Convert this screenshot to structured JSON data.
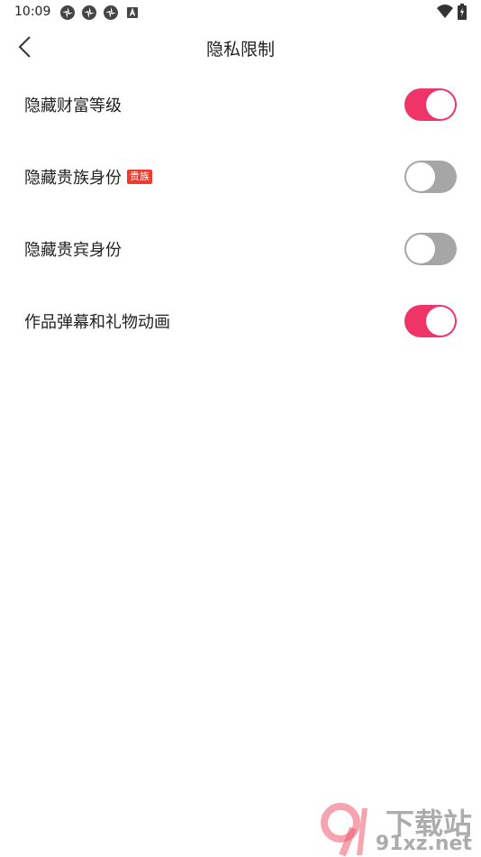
{
  "status_bar": {
    "time": "10:09",
    "left_icons": [
      "app-notification-icon",
      "app-notification-icon",
      "app-notification-icon",
      "text-a-icon"
    ],
    "right_icons": [
      "wifi-icon",
      "battery-charging-icon"
    ]
  },
  "header": {
    "title": "隐私限制",
    "back_icon": "chevron-left-icon"
  },
  "settings": [
    {
      "label": "隐藏财富等级",
      "badge": "",
      "state": "on"
    },
    {
      "label": "隐藏贵族身份",
      "badge": "贵族",
      "state": "off"
    },
    {
      "label": "隐藏贵宾身份",
      "badge": "",
      "state": "off"
    },
    {
      "label": "作品弹幕和礼物动画",
      "badge": "",
      "state": "on"
    }
  ],
  "colors": {
    "toggle_on": "#ef3467",
    "toggle_off": "#a6a6a6",
    "badge": "#ef3b2d"
  },
  "watermark": {
    "title": "下载站",
    "site": "91xz.net"
  }
}
